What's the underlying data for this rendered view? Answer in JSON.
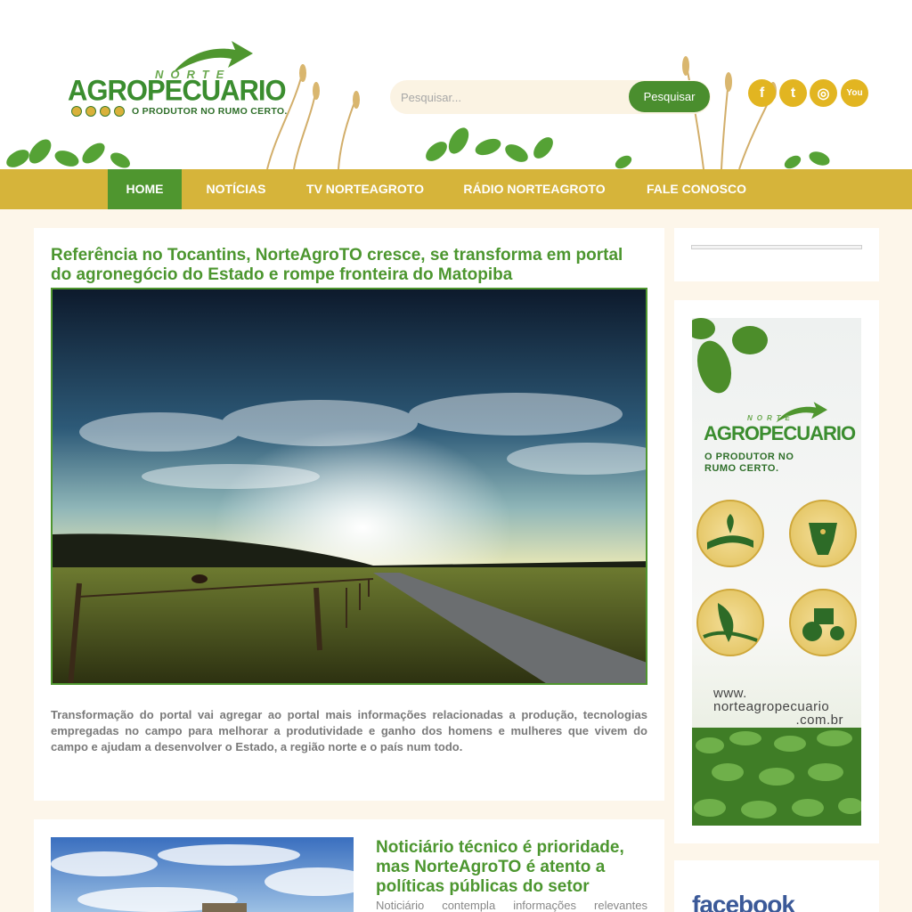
{
  "header": {
    "logo": {
      "norte": "NORTE",
      "brand": "AGROPECUARIO",
      "tagline": "O PRODUTOR NO RUMO CERTO."
    },
    "search": {
      "placeholder": "Pesquisar...",
      "button_label": "Pesquisar"
    },
    "social": [
      {
        "icon": "facebook-icon",
        "glyph": "f"
      },
      {
        "icon": "twitter-icon",
        "glyph": "t"
      },
      {
        "icon": "instagram-icon",
        "glyph": "◎"
      },
      {
        "icon": "youtube-icon",
        "glyph": "You"
      }
    ]
  },
  "nav": {
    "items": [
      {
        "label": "HOME",
        "active": true
      },
      {
        "label": "NOTÍCIAS",
        "active": false
      },
      {
        "label": "TV NORTEAGROTO",
        "active": false
      },
      {
        "label": "RÁDIO NORTEAGROTO",
        "active": false
      },
      {
        "label": "FALE CONOSCO",
        "active": false
      }
    ]
  },
  "main": {
    "featured": {
      "title": "Referência no Tocantins, NorteAgroTO cresce, se transforma em portal do agronegócio do Estado e rompe fronteira do Matopiba",
      "excerpt": "Transformação do portal vai agregar ao portal mais informações relacionadas a produção, tecnologias empregadas no campo para melhorar a produtividade e ganho dos homens e mulheres que vivem do campo e ajudam a desenvolver o Estado, a região norte e o país num todo."
    },
    "second": {
      "title": "Noticiário técnico é prioridade, mas NorteAgroTO é atento a políticas públicas do setor",
      "excerpt": "Noticiário contempla informações relevantes"
    }
  },
  "sidebar": {
    "ad": {
      "norte": "NORTE",
      "brand": "AGROPECUARIO",
      "slogan": "O PRODUTOR NO RUMO CERTO.",
      "url_line1": "www.",
      "url_line2": "norteagropecuario",
      "url_line3": ".com.br"
    },
    "facebook_label": "facebook"
  },
  "colors": {
    "green": "#4f962f",
    "gold": "#d6b43a",
    "cream": "#fdf6ea"
  }
}
